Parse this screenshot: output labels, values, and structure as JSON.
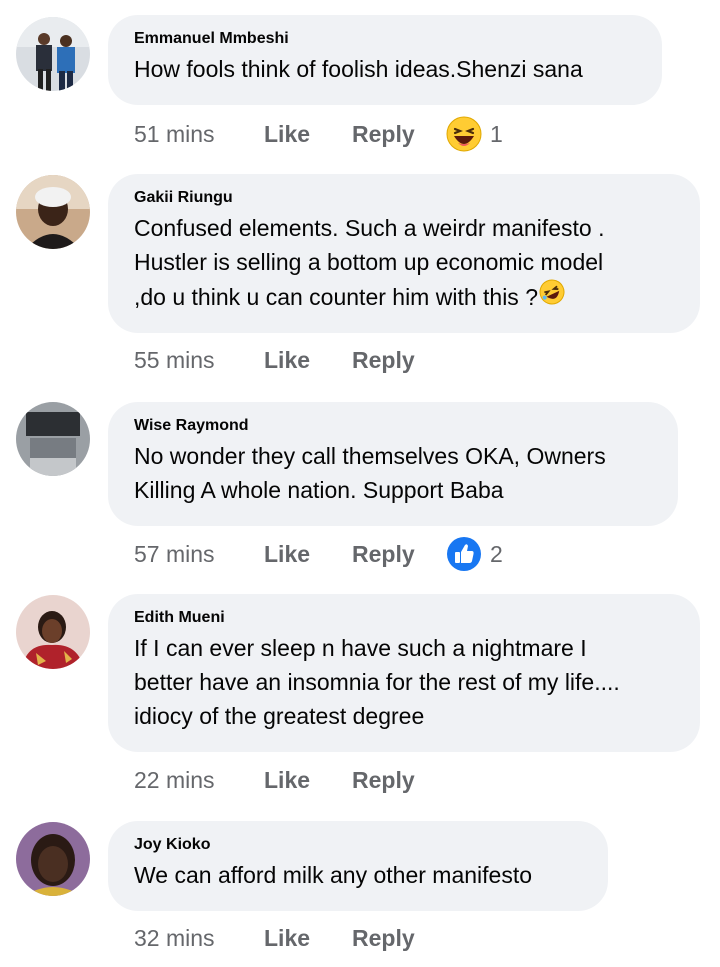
{
  "comments": [
    {
      "author": "Emmanuel Mmbeshi",
      "lines": [
        "How fools think of foolish ideas.Shenzi sana"
      ],
      "time": "51 mins",
      "like_label": "Like",
      "reply_label": "Reply",
      "reaction": {
        "icon": "haha-emoji-icon",
        "count": "1"
      }
    },
    {
      "author": "Gakii Riungu",
      "lines": [
        "Confused elements. Such a weirdr manifesto .",
        "Hustler is selling a bottom up  economic model",
        ",do u think u can counter him with this ?"
      ],
      "inline_emoji": "rofl-emoji-icon",
      "time": "55 mins",
      "like_label": "Like",
      "reply_label": "Reply"
    },
    {
      "author": "Wise Raymond",
      "lines": [
        "No wonder they call themselves OKA, Owners",
        "Killing A whole nation. Support Baba"
      ],
      "time": "57 mins",
      "like_label": "Like",
      "reply_label": "Reply",
      "reaction": {
        "icon": "like-thumb-icon",
        "count": "2"
      }
    },
    {
      "author": "Edith Mueni",
      "lines": [
        "If I can ever sleep n have such a nightmare I",
        "better have an insomnia for the rest of my life....",
        "idiocy of the greatest degree"
      ],
      "time": "22 mins",
      "like_label": "Like",
      "reply_label": "Reply"
    },
    {
      "author": "Joy Kioko",
      "lines": [
        "We can afford milk any other manifesto"
      ],
      "time": "32 mins",
      "like_label": "Like",
      "reply_label": "Reply"
    }
  ],
  "colors": {
    "bubble": "#f0f2f5",
    "text": "#050505",
    "meta": "#65676b",
    "like_blue": "#1877f2",
    "emoji_yellow": "#ffcc33"
  }
}
